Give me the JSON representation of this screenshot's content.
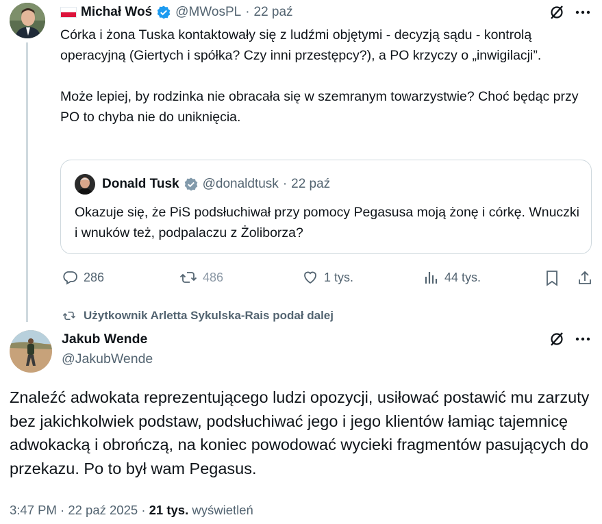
{
  "tweet1": {
    "author_name": "Michał Woś",
    "handle": "@MWosPL",
    "separator": "·",
    "date": "22 paź",
    "body_p1": "Córka i żona Tuska kontaktowały się z ludźmi objętymi - decyzją sądu - kontrolą operacyjną (Giertych i spółka? Czy inni przestępcy?), a PO krzyczy o „inwigilacji”.",
    "body_p2": "Może lepiej, by rodzinka nie obracała się w szemranym towarzystwie? Choć będąc przy PO to chyba nie do uniknięcia.",
    "quote": {
      "author_name": "Donald Tusk",
      "handle": "@donaldtusk",
      "separator": "·",
      "date": "22 paź",
      "body": "Okazuje się, że PiS podsłuchiwał przy pomocy Pegasusa moją żonę i córkę. Wnuczki i wnuków też, podpalaczu z Żoliborza?"
    },
    "actions": {
      "replies": "286",
      "reposts": "486",
      "likes": "1 tys.",
      "views": "44 tys."
    }
  },
  "repost_banner": "Użytkownik Arletta Sykulska-Rais podał dalej",
  "tweet2": {
    "author_name": "Jakub Wende",
    "handle": "@JakubWende",
    "body": "Znaleźć adwokata reprezentującego ludzi opozycji, usiłować postawić mu zarzuty bez jakichkolwiek podstaw, podsłuchiwać jego i jego klientów łamiąc tajemnicę adwokacką i obrończą, na koniec powodować wycieki fragmentów pasujących do przekazu. Po to był wam Pegasus.",
    "timestamp": "3:47 PM · 22 paź 2025 · ",
    "views_count": "21 tys.",
    "views_label": " wyświetleń"
  },
  "colors": {
    "verified": "#1d9bf0",
    "muted": "#536471",
    "thread_line": "#cfd9de",
    "border": "#cfd9de"
  }
}
